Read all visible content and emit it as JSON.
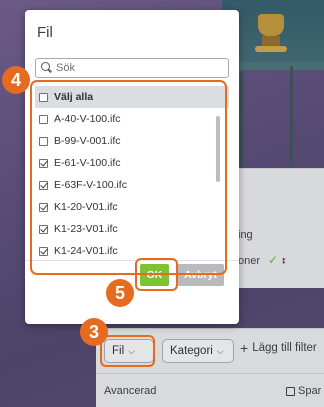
{
  "dialog": {
    "title": "Fil",
    "search_placeholder": "Sök",
    "items": [
      {
        "label": "Välj alla",
        "checked": false
      },
      {
        "label": "A-40-V-100.ifc",
        "checked": false
      },
      {
        "label": "B-99-V-001.ifc",
        "checked": false
      },
      {
        "label": "E-61-V-100.ifc",
        "checked": true
      },
      {
        "label": "E-63F-V-100.ifc",
        "checked": true
      },
      {
        "label": "K1-20-V01.ifc",
        "checked": true
      },
      {
        "label": "K1-23-V01.ifc",
        "checked": true
      },
      {
        "label": "K1-24-V01.ifc",
        "checked": true
      }
    ],
    "ok_label": "OK",
    "cancel_label": "Avbryt"
  },
  "background_panel": {
    "row1": "ing",
    "row2": "oner"
  },
  "filter_bar": {
    "fil_label": "Fil",
    "kategori_label": "Kategori",
    "add_filter_label": "Lägg till filter",
    "advanced_label": "Avancerad",
    "save_label": "Spar"
  },
  "steps": {
    "step3": "3",
    "step4": "4",
    "step5": "5"
  },
  "colors": {
    "accent_orange": "#e66a1f",
    "ok_green": "#7ec236",
    "cancel_gray": "#b8babd"
  }
}
